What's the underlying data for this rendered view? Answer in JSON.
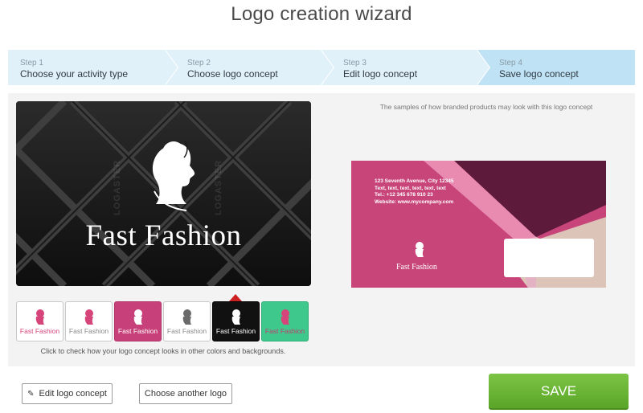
{
  "page": {
    "title": "Logo creation wizard"
  },
  "steps": [
    {
      "num": "Step 1",
      "label": "Choose your activity type"
    },
    {
      "num": "Step 2",
      "label": "Choose logo concept"
    },
    {
      "num": "Step 3",
      "label": "Edit logo concept"
    },
    {
      "num": "Step 4",
      "label": "Save logo concept",
      "active": true
    }
  ],
  "preview": {
    "brand_name": "Fast Fashion",
    "watermark": "LOGASTER",
    "background_color": "#1a1a1a",
    "icon": "woman-silhouette-icon"
  },
  "swatches": [
    {
      "caption": "Fast Fashion",
      "bg": "#ffffff",
      "icon_color": "#d6457a",
      "text_color": "#d6457a"
    },
    {
      "caption": "Fast Fashion",
      "bg": "#ffffff",
      "icon_color": "#d6457a",
      "text_color": "#777777"
    },
    {
      "caption": "Fast Fashion",
      "bg": "#c8407a",
      "icon_color": "#ffffff",
      "text_color": "#ffffff"
    },
    {
      "caption": "Fast Fashion",
      "bg": "#ffffff",
      "icon_color": "#6a6a6a",
      "text_color": "#777777"
    },
    {
      "caption": "Fast Fashion",
      "bg": "#111111",
      "icon_color": "#ffffff",
      "text_color": "#ffffff",
      "selected": true
    },
    {
      "caption": "Fast Fashion",
      "bg": "#3ec88c",
      "icon_color": "#d6457a",
      "text_color": "#d6457a"
    }
  ],
  "hint": "Click to check how your logo concept looks in other colors and backgrounds.",
  "samples": {
    "caption": "The samples of how branded products may look with this logo concept",
    "envelope": {
      "address": "123 Seventh Avenue, City 12345",
      "text_line": "Text, text, text, text, text, text",
      "tel": "Tel.: +12 345 678 910 23",
      "website": "Website: www.mycompany.com",
      "brand_name": "Fast Fashion"
    }
  },
  "buttons": {
    "edit": "Edit logo concept",
    "another": "Choose another logo",
    "save": "SAVE"
  },
  "colors": {
    "steps_bg": "#e1f1fa",
    "steps_active_bg": "#bfe2f5",
    "save_green": "#6cb637",
    "accent_pink": "#c8407a",
    "selected_arrow": "#cc2222"
  }
}
